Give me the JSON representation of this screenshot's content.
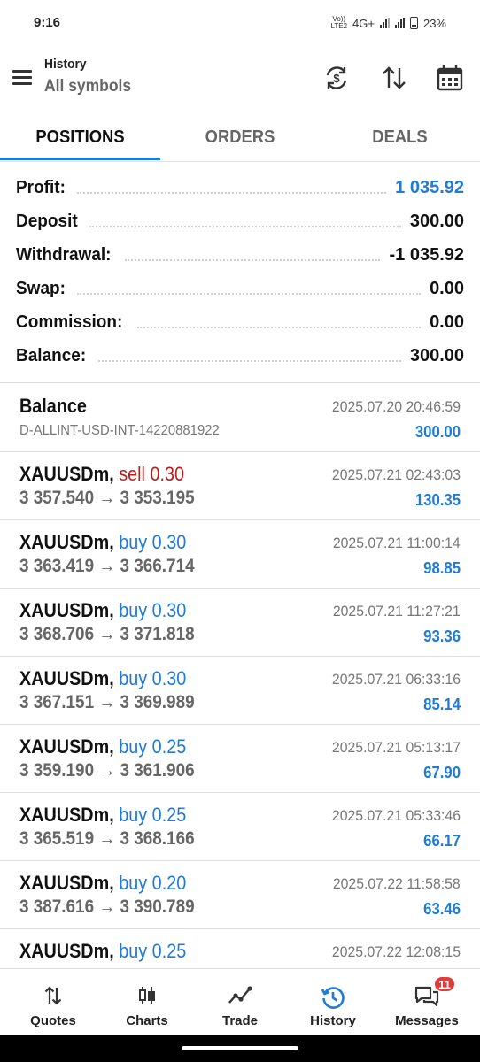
{
  "status_bar": {
    "time": "9:16",
    "network": "4G+",
    "volte": "VoLTE2",
    "battery": "23%"
  },
  "header": {
    "title": "History",
    "subtitle": "All symbols"
  },
  "tabs": [
    {
      "label": "POSITIONS",
      "active": true
    },
    {
      "label": "ORDERS",
      "active": false
    },
    {
      "label": "DEALS",
      "active": false
    }
  ],
  "summary": [
    {
      "label": "Profit:",
      "value": "1 035.92",
      "accent": "blue"
    },
    {
      "label": "Deposit",
      "value": "300.00"
    },
    {
      "label": "Withdrawal:",
      "value": "-1 035.92"
    },
    {
      "label": "Swap:",
      "value": "0.00"
    },
    {
      "label": "Commission:",
      "value": "0.00"
    },
    {
      "label": "Balance:",
      "value": "300.00"
    }
  ],
  "balance_entry": {
    "title": "Balance",
    "comment": "D-ALLINT-USD-INT-14220881922",
    "time": "2025.07.20 20:46:59",
    "amount": "300.00"
  },
  "positions": [
    {
      "symbol": "XAUUSDm,",
      "side": "sell",
      "volume": "0.30",
      "open": "3 357.540",
      "arrow": "→",
      "close": "3 353.195",
      "time": "2025.07.21 02:43:03",
      "profit": "130.35"
    },
    {
      "symbol": "XAUUSDm,",
      "side": "buy",
      "volume": "0.30",
      "open": "3 363.419",
      "arrow": "→",
      "close": "3 366.714",
      "time": "2025.07.21 11:00:14",
      "profit": "98.85"
    },
    {
      "symbol": "XAUUSDm,",
      "side": "buy",
      "volume": "0.30",
      "open": "3 368.706",
      "arrow": "→",
      "close": "3 371.818",
      "time": "2025.07.21 11:27:21",
      "profit": "93.36"
    },
    {
      "symbol": "XAUUSDm,",
      "side": "buy",
      "volume": "0.30",
      "open": "3 367.151",
      "arrow": "→",
      "close": "3 369.989",
      "time": "2025.07.21 06:33:16",
      "profit": "85.14"
    },
    {
      "symbol": "XAUUSDm,",
      "side": "buy",
      "volume": "0.25",
      "open": "3 359.190",
      "arrow": "→",
      "close": "3 361.906",
      "time": "2025.07.21 05:13:17",
      "profit": "67.90"
    },
    {
      "symbol": "XAUUSDm,",
      "side": "buy",
      "volume": "0.25",
      "open": "3 365.519",
      "arrow": "→",
      "close": "3 368.166",
      "time": "2025.07.21 05:33:46",
      "profit": "66.17"
    },
    {
      "symbol": "XAUUSDm,",
      "side": "buy",
      "volume": "0.20",
      "open": "3 387.616",
      "arrow": "→",
      "close": "3 390.789",
      "time": "2025.07.22 11:58:58",
      "profit": "63.46"
    },
    {
      "symbol": "XAUUSDm,",
      "side": "buy",
      "volume": "0.25",
      "open": "",
      "arrow": "",
      "close": "",
      "time": "2025.07.22 12:08:15",
      "profit": ""
    }
  ],
  "bottom_nav": [
    {
      "label": "Quotes",
      "icon": "quotes-arrows-icon",
      "active": false
    },
    {
      "label": "Charts",
      "icon": "candlestick-icon",
      "active": false
    },
    {
      "label": "Trade",
      "icon": "trend-line-icon",
      "active": false
    },
    {
      "label": "History",
      "icon": "history-clock-icon",
      "active": true
    },
    {
      "label": "Messages",
      "icon": "chat-bubbles-icon",
      "active": false,
      "badge": "11"
    }
  ],
  "colors": {
    "accent": "#1f7bd3",
    "sell": "#c21a1a",
    "badge": "#e23b3b"
  }
}
